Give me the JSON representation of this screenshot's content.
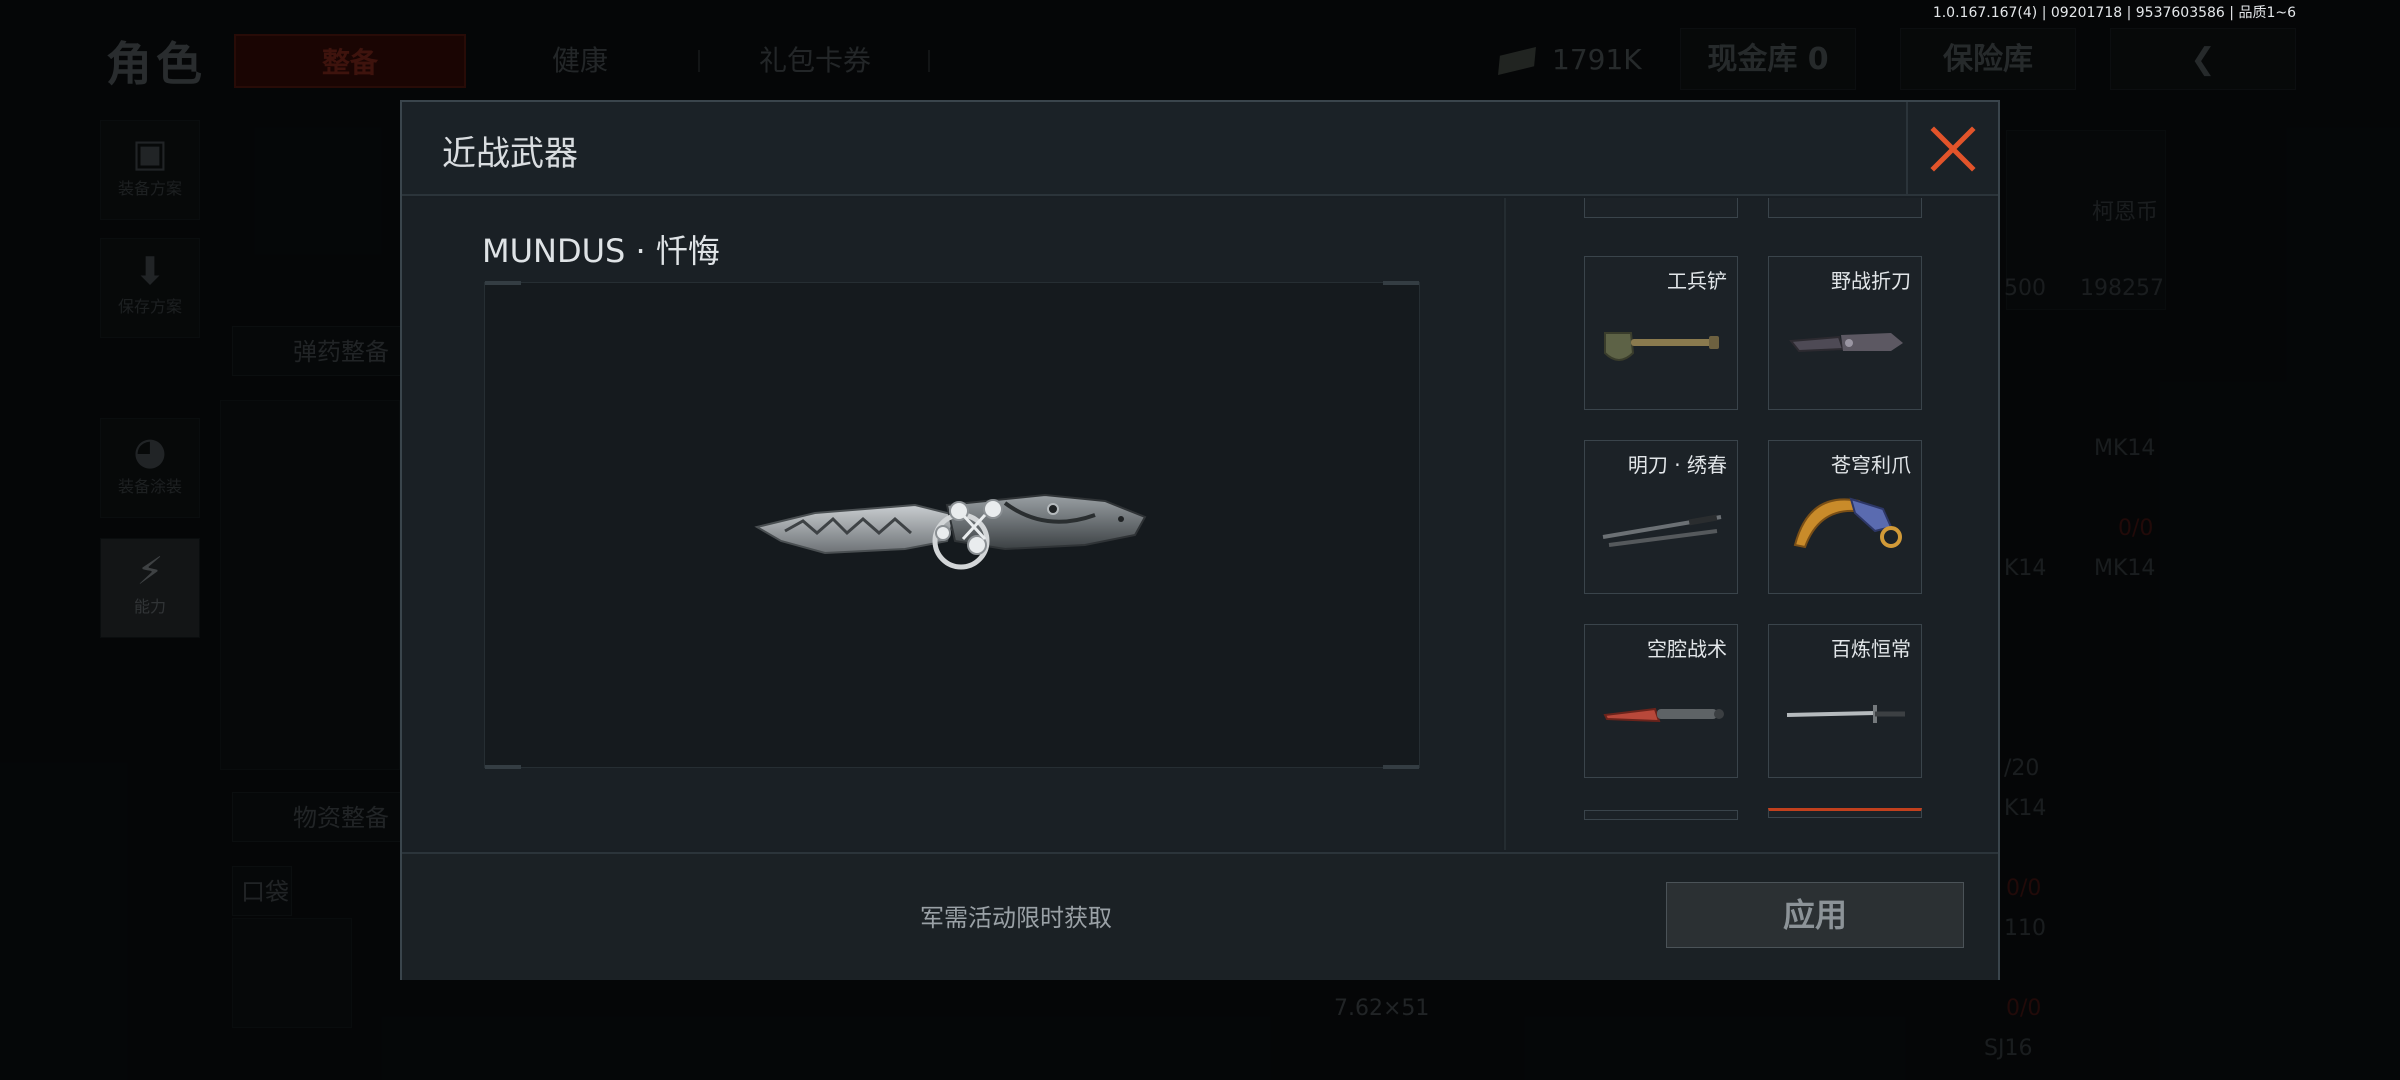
{
  "version": "1.0.167.167(4) | 09201718 | 9537603586 | 品质1~6",
  "background": {
    "page_title": "角色",
    "tabs": [
      {
        "label": "整备"
      },
      {
        "label": "健康"
      },
      {
        "label": "礼包卡券"
      }
    ],
    "currency_amount": "1791K",
    "cash_vault": "现金库 0",
    "insurance_vault": "保险库",
    "back_arrow": "❮",
    "rail": [
      {
        "label": "装备方案",
        "icon": "vest-icon",
        "glyph": "▣"
      },
      {
        "label": "保存方案",
        "icon": "save-icon",
        "glyph": "⬇"
      },
      {
        "label": "装备涂装",
        "icon": "helmet-icon",
        "glyph": "◕"
      },
      {
        "label": "能力",
        "icon": "ability-icon",
        "glyph": "⚡"
      }
    ],
    "sections": {
      "ammo": "弹药整备",
      "supplies": "物资整备",
      "pocket": "口袋"
    },
    "grid_texts": [
      "柯恩币",
      "198257",
      "500",
      "MK14",
      "MK14",
      "0/0",
      "K14",
      "/20",
      "K14",
      "0/0",
      "110",
      "0/0",
      "SJ16"
    ],
    "caliber": "7.62×51"
  },
  "modal": {
    "title": "近战武器",
    "selected_item_name": "MUNDUS · 忏悔",
    "items": [
      {
        "label": "工兵铲",
        "icon": "shovel-icon"
      },
      {
        "label": "野战折刀",
        "icon": "folding-knife-icon"
      },
      {
        "label": "明刀 · 绣春",
        "icon": "twin-blades-icon"
      },
      {
        "label": "苍穹利爪",
        "icon": "karambit-icon"
      },
      {
        "label": "空腔战术",
        "icon": "tactical-knife-icon"
      },
      {
        "label": "百炼恒常",
        "icon": "sword-icon"
      }
    ],
    "footer_note": "军需活动限时获取",
    "apply_label": "应用"
  },
  "colors": {
    "close_accent": "#e2542a",
    "modal_bg": "#191f24",
    "active_tab_bg": "#3a0d08"
  }
}
